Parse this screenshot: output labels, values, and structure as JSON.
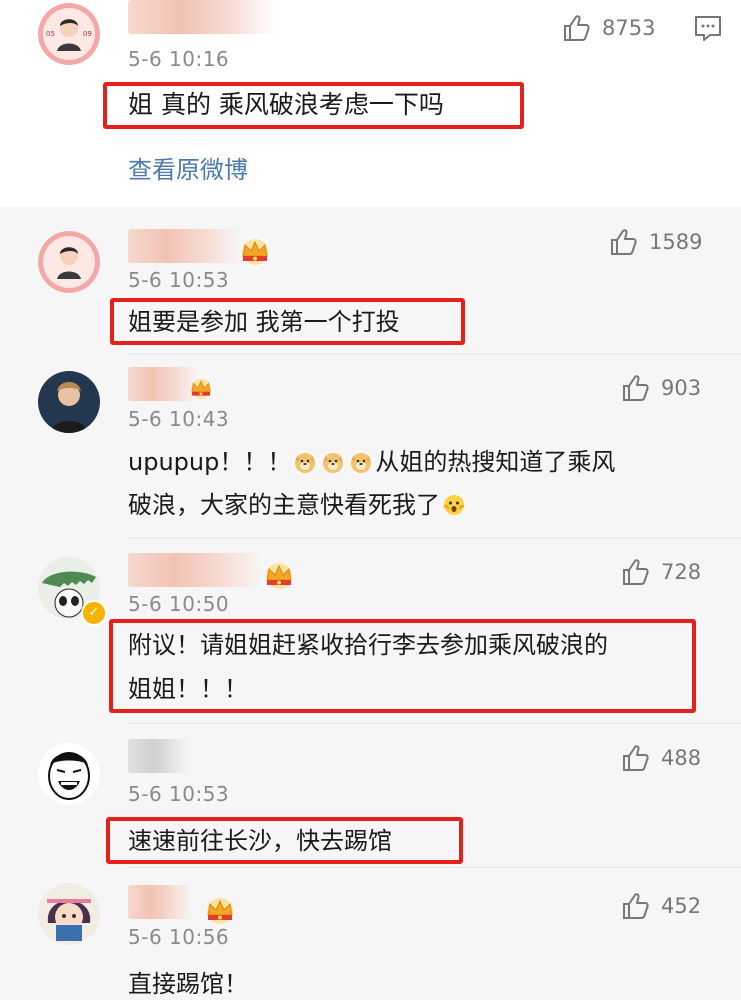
{
  "main_comment": {
    "timestamp": "5-6 10:16",
    "like_count": "8753",
    "text": "姐 真的 乘风破浪考虑一下吗",
    "view_original": "查看原微博"
  },
  "replies": [
    {
      "timestamp": "5-6 10:53",
      "like_count": "1589",
      "text": "姐要是参加 我第一个打投"
    },
    {
      "timestamp": "5-6 10:43",
      "like_count": "903",
      "text_start": "upupup！！！",
      "text_mid": "从姐的热搜知道了乘风",
      "text_line2": "破浪，大家的主意快看死我了"
    },
    {
      "timestamp": "5-6 10:50",
      "like_count": "728",
      "text_line1": "附议！请姐姐赶紧收拾行李去参加乘风破浪的",
      "text_line2": "姐姐！！！"
    },
    {
      "timestamp": "5-6 10:53",
      "like_count": "488",
      "text": "速速前往长沙，快去踢馆"
    },
    {
      "timestamp": "5-6 10:56",
      "like_count": "452",
      "text": "直接踢馆！"
    }
  ],
  "colors": {
    "highlight": "#e5211c",
    "link": "#4c79b0",
    "reply_bg": "#f6f6f6",
    "crown": "#f5a623"
  },
  "icons": [
    "thumbs-up-icon",
    "reply-icon",
    "crown-icon",
    "doge-emoji",
    "surprised-emoji"
  ]
}
